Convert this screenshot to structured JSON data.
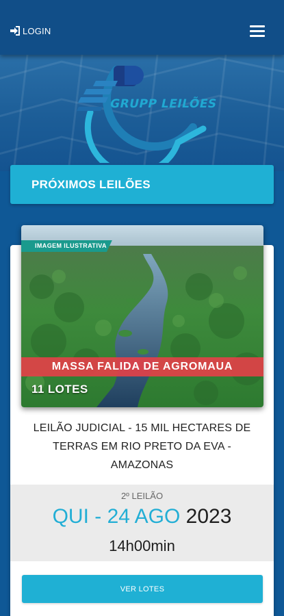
{
  "header": {
    "login_label": "LOGIN",
    "login_icon": "sign-in-icon",
    "menu_icon": "hamburger-menu-icon"
  },
  "hero": {
    "logo_text": "GRUPP LEILÕES"
  },
  "section": {
    "title": "PRÓXIMOS LEILÕES"
  },
  "auction": {
    "tag": "IMAGEM ILUSTRATIVA",
    "banner": "MASSA FALIDA DE AGROMAUA",
    "lots": "11 LOTES",
    "title": "LEILÃO JUDICIAL - 15 MIL HECTARES DE TERRAS EM RIO PRETO DA EVA - AMAZONAS",
    "round": "2º LEILÃO",
    "date_day": "QUI - 24 AGO",
    "date_year": "2023",
    "time": "14h00min",
    "button_label": "VER LOTES"
  },
  "colors": {
    "primary": "#114e88",
    "accent": "#1fb0d4",
    "banner_red": "#e44048",
    "tag_teal": "#1a9a8d"
  }
}
